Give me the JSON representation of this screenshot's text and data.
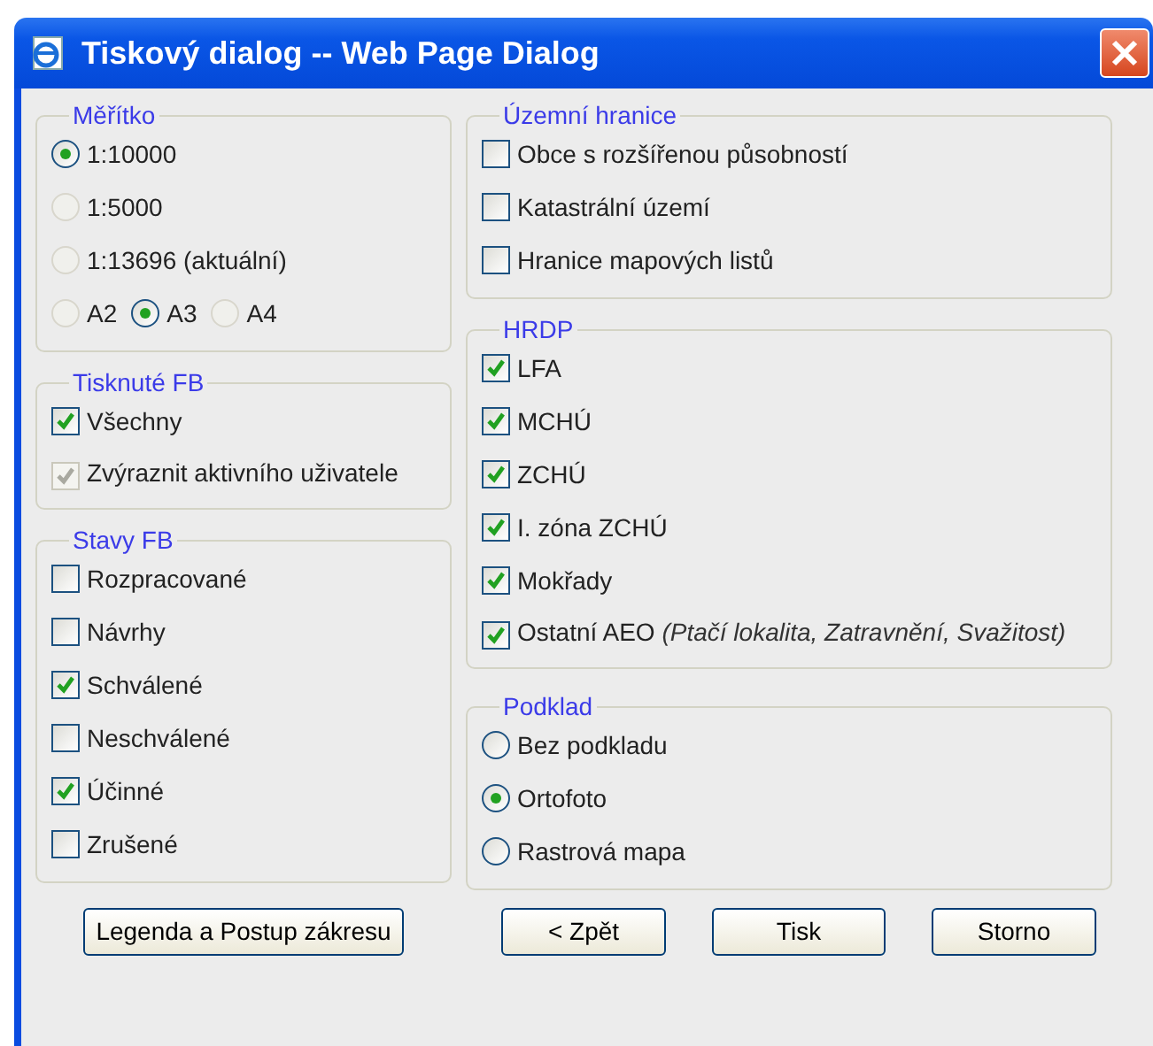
{
  "window": {
    "title": "Tiskový dialog -- Web Page Dialog"
  },
  "scale": {
    "legend": "Měřítko",
    "options": [
      {
        "label": "1:10000",
        "selected": true,
        "disabled": false
      },
      {
        "label": "1:5000",
        "selected": false,
        "disabled": true
      },
      {
        "label": "1:13696 (aktuální)",
        "selected": false,
        "disabled": true
      }
    ],
    "paper": [
      {
        "label": "A2",
        "selected": false,
        "disabled": true
      },
      {
        "label": "A3",
        "selected": true,
        "disabled": false
      },
      {
        "label": "A4",
        "selected": false,
        "disabled": true
      }
    ]
  },
  "printed_fb": {
    "legend": "Tisknuté FB",
    "items": [
      {
        "label": "Všechny",
        "checked": true,
        "disabled": false
      },
      {
        "label": "Zvýraznit aktivního uživatele",
        "checked": true,
        "disabled": true
      }
    ]
  },
  "fb_states": {
    "legend": "Stavy FB",
    "items": [
      {
        "label": "Rozpracované",
        "checked": false,
        "disabled": false
      },
      {
        "label": "Návrhy",
        "checked": false,
        "disabled": false
      },
      {
        "label": "Schválené",
        "checked": true,
        "disabled": false
      },
      {
        "label": "Neschválené",
        "checked": false,
        "disabled": false
      },
      {
        "label": "Účinné",
        "checked": true,
        "disabled": false
      },
      {
        "label": "Zrušené",
        "checked": false,
        "disabled": false
      }
    ]
  },
  "boundaries": {
    "legend": "Územní hranice",
    "items": [
      {
        "label": "Obce s rozšířenou působností",
        "checked": false,
        "disabled": false
      },
      {
        "label": "Katastrální území",
        "checked": false,
        "disabled": false
      },
      {
        "label": "Hranice mapových listů",
        "checked": false,
        "disabled": false
      }
    ]
  },
  "hrdp": {
    "legend": "HRDP",
    "items": [
      {
        "label": "LFA",
        "checked": true,
        "disabled": false
      },
      {
        "label": "MCHÚ",
        "checked": true,
        "disabled": false
      },
      {
        "label": "ZCHÚ",
        "checked": true,
        "disabled": false
      },
      {
        "label": "I. zóna ZCHÚ",
        "checked": true,
        "disabled": false
      },
      {
        "label": "Mokřady",
        "checked": true,
        "disabled": false
      },
      {
        "label": "Ostatní AEO",
        "note": "(Ptačí lokalita, Zatravnění, Svažitost)",
        "checked": true,
        "disabled": false
      }
    ]
  },
  "background": {
    "legend": "Podklad",
    "options": [
      {
        "label": "Bez podkladu",
        "selected": false,
        "disabled": false
      },
      {
        "label": "Ortofoto",
        "selected": true,
        "disabled": false
      },
      {
        "label": "Rastrová mapa",
        "selected": false,
        "disabled": false
      }
    ]
  },
  "buttons": {
    "left": [
      "Legenda a Postup zákresu"
    ],
    "right": [
      "< Zpět",
      "Tisk",
      "Storno"
    ]
  }
}
